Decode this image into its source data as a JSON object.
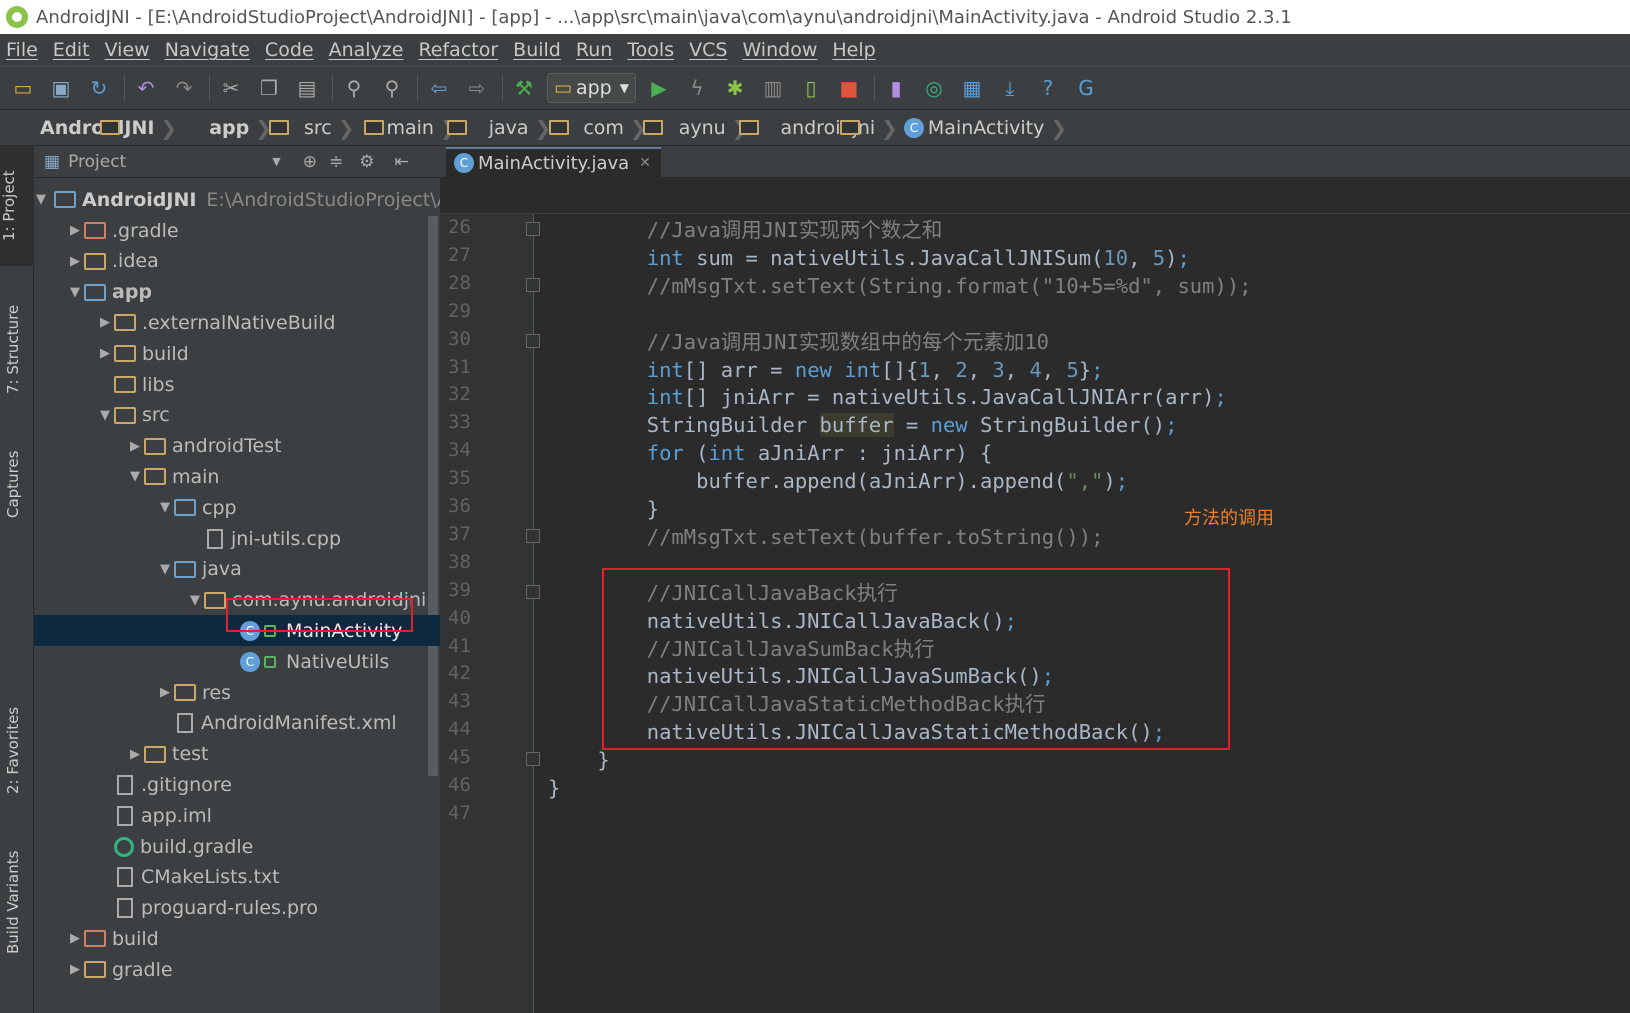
{
  "window": {
    "title": "AndroidJNI - [E:\\AndroidStudioProject\\AndroidJNI] - [app] - ...\\app\\src\\main\\java\\com\\aynu\\androidjni\\MainActivity.java - Android Studio 2.3.1"
  },
  "menu": [
    "File",
    "Edit",
    "View",
    "Navigate",
    "Code",
    "Analyze",
    "Refactor",
    "Build",
    "Run",
    "Tools",
    "VCS",
    "Window",
    "Help"
  ],
  "toolbar": {
    "config": "app"
  },
  "breadcrumbs": [
    "AndroidJNI",
    "app",
    "src",
    "main",
    "java",
    "com",
    "aynu",
    "androidjni",
    "MainActivity"
  ],
  "side_tabs": [
    "1: Project",
    "7: Structure",
    "Captures",
    "2: Favorites",
    "Build Variants"
  ],
  "project_panel": {
    "header": "Project",
    "root_name": "AndroidJNI",
    "root_path": "E:\\AndroidStudioProject\\AndroidJNI",
    "items": [
      {
        "label": ".gradle",
        "depth": 1
      },
      {
        "label": ".idea",
        "depth": 1
      },
      {
        "label": "app",
        "depth": 1
      },
      {
        "label": ".externalNativeBuild",
        "depth": 2
      },
      {
        "label": "build",
        "depth": 2
      },
      {
        "label": "libs",
        "depth": 2
      },
      {
        "label": "src",
        "depth": 2
      },
      {
        "label": "androidTest",
        "depth": 3
      },
      {
        "label": "main",
        "depth": 3
      },
      {
        "label": "cpp",
        "depth": 4
      },
      {
        "label": "jni-utils.cpp",
        "depth": 5
      },
      {
        "label": "java",
        "depth": 4
      },
      {
        "label": "com.aynu.androidjni",
        "depth": 5
      },
      {
        "label": "MainActivity",
        "depth": 6
      },
      {
        "label": "NativeUtils",
        "depth": 6
      },
      {
        "label": "res",
        "depth": 4
      },
      {
        "label": "AndroidManifest.xml",
        "depth": 4
      },
      {
        "label": "test",
        "depth": 3
      },
      {
        "label": ".gitignore",
        "depth": 2
      },
      {
        "label": "app.iml",
        "depth": 2
      },
      {
        "label": "build.gradle",
        "depth": 2
      },
      {
        "label": "CMakeLists.txt",
        "depth": 2
      },
      {
        "label": "proguard-rules.pro",
        "depth": 2
      },
      {
        "label": "build",
        "depth": 1
      },
      {
        "label": "gradle",
        "depth": 1
      }
    ]
  },
  "editor": {
    "tab": "MainActivity.java",
    "annotation": "方法的调用",
    "lines": [
      {
        "n": "26",
        "t": "        //Java调用JNI实现两个数之和"
      },
      {
        "n": "27",
        "t": "        int sum = nativeUtils.JavaCallJNISum(10, 5);"
      },
      {
        "n": "28",
        "t": "        //mMsgTxt.setText(String.format(\"10+5=%d\", sum));"
      },
      {
        "n": "29",
        "t": ""
      },
      {
        "n": "30",
        "t": "        //Java调用JNI实现数组中的每个元素加10"
      },
      {
        "n": "31",
        "t": "        int[] arr = new int[]{1, 2, 3, 4, 5};"
      },
      {
        "n": "32",
        "t": "        int[] jniArr = nativeUtils.JavaCallJNIArr(arr);"
      },
      {
        "n": "33",
        "t": "        StringBuilder buffer = new StringBuilder();"
      },
      {
        "n": "34",
        "t": "        for (int aJniArr : jniArr) {"
      },
      {
        "n": "35",
        "t": "            buffer.append(aJniArr).append(\",\");"
      },
      {
        "n": "36",
        "t": "        }"
      },
      {
        "n": "37",
        "t": "        //mMsgTxt.setText(buffer.toString());"
      },
      {
        "n": "38",
        "t": ""
      },
      {
        "n": "39",
        "t": "        //JNICallJavaBack执行"
      },
      {
        "n": "40",
        "t": "        nativeUtils.JNICallJavaBack();"
      },
      {
        "n": "41",
        "t": "        //JNICallJavaSumBack执行"
      },
      {
        "n": "42",
        "t": "        nativeUtils.JNICallJavaSumBack();"
      },
      {
        "n": "43",
        "t": "        //JNICallJavaStaticMethodBack执行"
      },
      {
        "n": "44",
        "t": "        nativeUtils.JNICallJavaStaticMethodBack();"
      },
      {
        "n": "45",
        "t": "    }"
      },
      {
        "n": "46",
        "t": "}"
      },
      {
        "n": "47",
        "t": ""
      }
    ]
  }
}
